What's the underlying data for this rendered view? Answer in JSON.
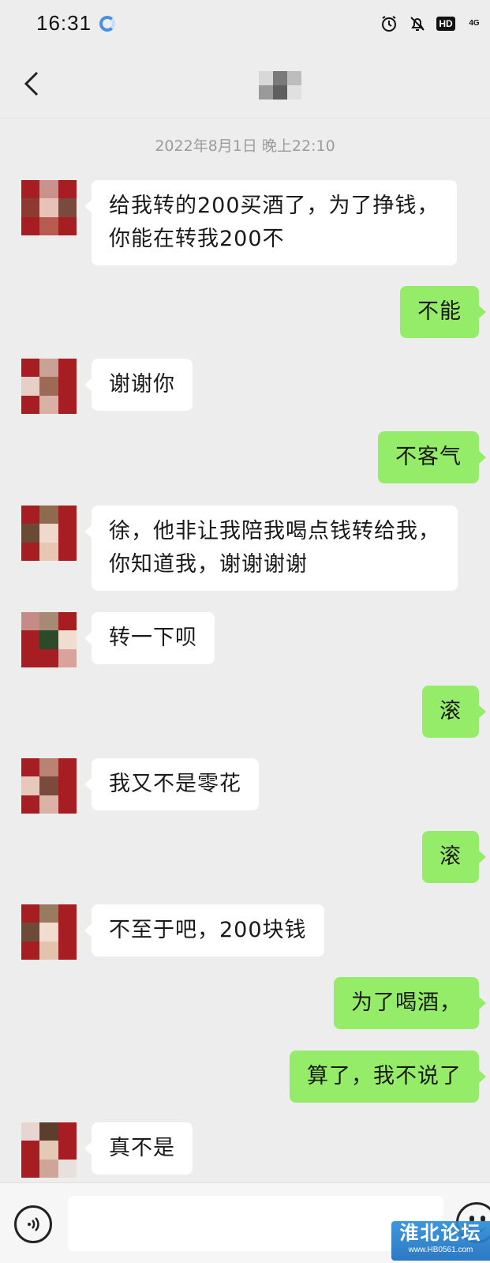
{
  "status_bar": {
    "time": "16:31",
    "icons": [
      "loading-icon",
      "alarm-icon",
      "mute-bell-icon",
      "hd-icon",
      "network-icon"
    ],
    "hd_label": "HD",
    "network_label": "4G"
  },
  "header": {
    "back_icon": "chevron-left-icon",
    "contact_name": ""
  },
  "chat": {
    "timestamp": "2022年8月1日 晚上22:10",
    "messages": [
      {
        "side": "in",
        "text": "给我转的200买酒了，为了挣钱，\n你能在转我200不"
      },
      {
        "side": "out",
        "text": "不能"
      },
      {
        "side": "in",
        "text": "谢谢你"
      },
      {
        "side": "out",
        "text": "不客气"
      },
      {
        "side": "in",
        "text": "徐，他非让我陪我喝点钱转给我，\n你知道我，谢谢谢谢"
      },
      {
        "side": "in",
        "text": "转一下呗"
      },
      {
        "side": "out",
        "text": "滚"
      },
      {
        "side": "in",
        "text": "我又不是零花"
      },
      {
        "side": "out",
        "text": "滚"
      },
      {
        "side": "in",
        "text": "不至于吧，200块钱"
      },
      {
        "side": "out",
        "text": "为了喝酒，"
      },
      {
        "side": "out",
        "text": "算了，我不说了"
      },
      {
        "side": "in",
        "text": "真不是"
      }
    ]
  },
  "input_bar": {
    "voice_icon": "voice-icon",
    "placeholder": "",
    "emoji_icon": "emoji-icon"
  },
  "watermark": {
    "title": "淮北论坛",
    "url": "www.HB0561.com"
  },
  "colors": {
    "background": "#ededed",
    "incoming_bubble": "#ffffff",
    "outgoing_bubble": "#95ec69",
    "avatar_red": "#a61e22"
  }
}
